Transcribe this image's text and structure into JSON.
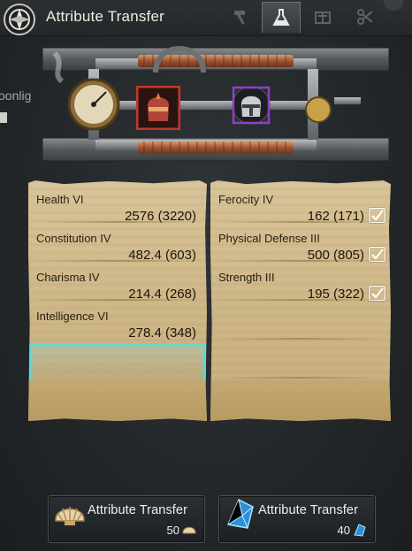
{
  "window": {
    "title": "Attribute Transfer"
  },
  "tabs": [
    {
      "icon": "hammer-icon"
    },
    {
      "icon": "flask-icon",
      "active": true
    },
    {
      "icon": "crate-icon"
    },
    {
      "icon": "scissors-icon"
    }
  ],
  "side": {
    "name_fragment": "oonlig"
  },
  "left_attributes": [
    {
      "name": "Health VI",
      "value": "2576 (3220)"
    },
    {
      "name": "Constitution IV",
      "value": "482.4 (603)"
    },
    {
      "name": "Charisma IV",
      "value": "214.4 (268)"
    },
    {
      "name": "Intelligence VI",
      "value": "278.4 (348)"
    }
  ],
  "right_attributes": [
    {
      "name": "Ferocity IV",
      "value": "162 (171)",
      "checked": true
    },
    {
      "name": "Physical Defense III",
      "value": "500 (805)",
      "checked": true
    },
    {
      "name": "Strength III",
      "value": "195 (322)",
      "checked": true
    }
  ],
  "buttons": [
    {
      "label": "Attribute Transfer",
      "count": "50",
      "icon": "shell-icon"
    },
    {
      "label": "Attribute Transfer",
      "count": "40",
      "icon": "crystal-icon"
    }
  ],
  "colors": {
    "selection": "#62d8d6",
    "source_frame": "#c0392b",
    "target_frame": "#8e3fc8",
    "parchment": "#d3be90"
  }
}
